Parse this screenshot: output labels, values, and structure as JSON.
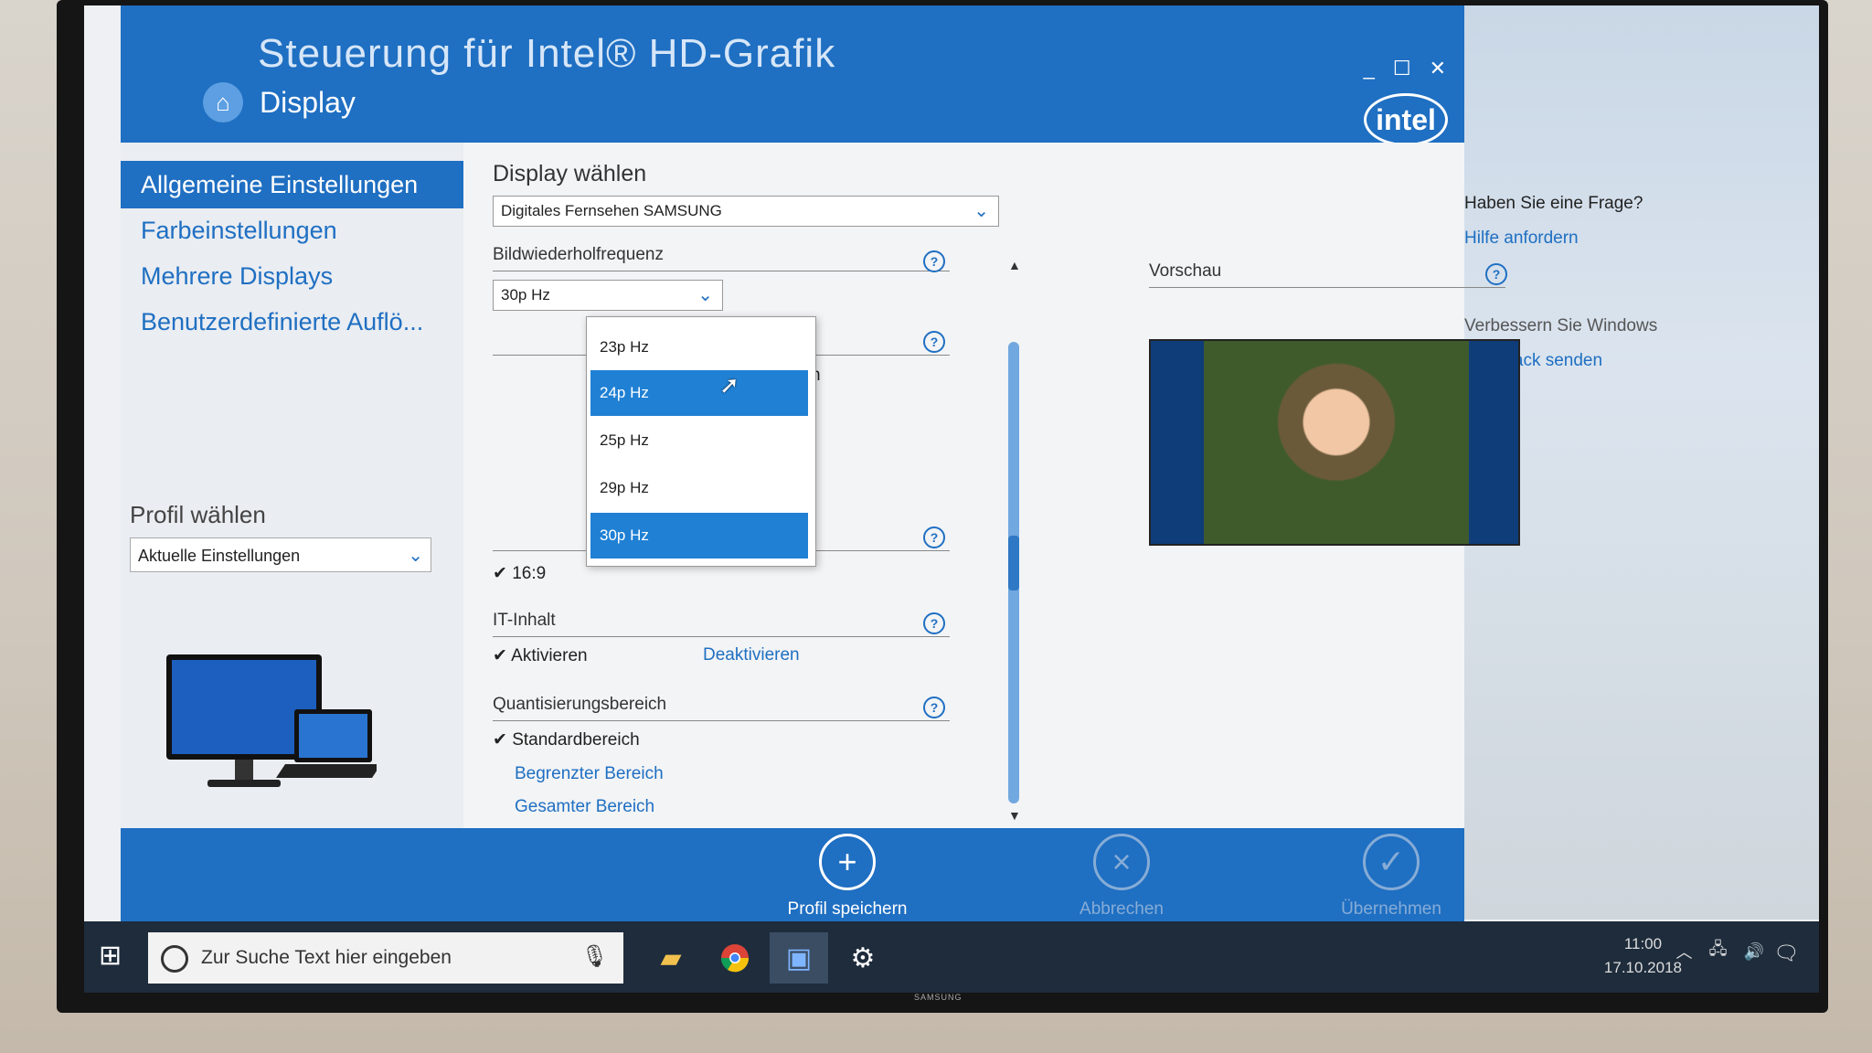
{
  "app": {
    "title": "Steuerung für Intel® HD-Grafik",
    "page": "Display",
    "logo": "intel"
  },
  "window_controls": {
    "minimize": "_",
    "maximize": "☐",
    "close": "✕"
  },
  "sidebar": {
    "items": [
      {
        "label": "Allgemeine Einstellungen",
        "active": true
      },
      {
        "label": "Farbeinstellungen",
        "active": false
      },
      {
        "label": "Mehrere Displays",
        "active": false
      },
      {
        "label": "Benutzerdefinierte Auflö...",
        "active": false
      }
    ],
    "profile_label": "Profil wählen",
    "profile_value": "Aktuelle Einstellungen"
  },
  "display_section": {
    "heading": "Display wählen",
    "value": "Digitales Fernsehen SAMSUNG"
  },
  "refresh": {
    "label": "Bildwiederholfrequenz",
    "value": "30p Hz",
    "options": [
      {
        "label": "23p Hz",
        "highlighted": false
      },
      {
        "label": "24p Hz",
        "highlighted": true
      },
      {
        "label": "25p Hz",
        "highlighted": false
      },
      {
        "label": "29p Hz",
        "highlighted": false
      },
      {
        "label": "30p Hz",
        "highlighted": true
      }
    ]
  },
  "hidden_fragments": {
    "partial_text": "n",
    "aspect": "16:9"
  },
  "it_content": {
    "label": "IT-Inhalt",
    "activate": "Aktivieren",
    "deactivate": "Deaktivieren"
  },
  "quantization": {
    "label": "Quantisierungsbereich",
    "standard": "Standardbereich",
    "limited": "Begrenzter Bereich",
    "full": "Gesamter Bereich"
  },
  "preview": {
    "label": "Vorschau"
  },
  "help_glyph": "?",
  "bottom_bar": {
    "save": "Profil speichern",
    "cancel": "Abbrechen",
    "apply": "Übernehmen"
  },
  "side_panel": {
    "question": "Haben Sie eine Frage?",
    "help_link": "Hilfe anfordern",
    "improve": "Verbessern Sie Windows",
    "feedback": "Feedback senden"
  },
  "taskbar": {
    "search_placeholder": "Zur Suche Text hier eingeben",
    "time": "11:00",
    "date": "17.10.2018"
  },
  "tv_brand": "SAMSUNG",
  "colors": {
    "accent": "#1f6fc2",
    "selection": "#1f80d4"
  }
}
